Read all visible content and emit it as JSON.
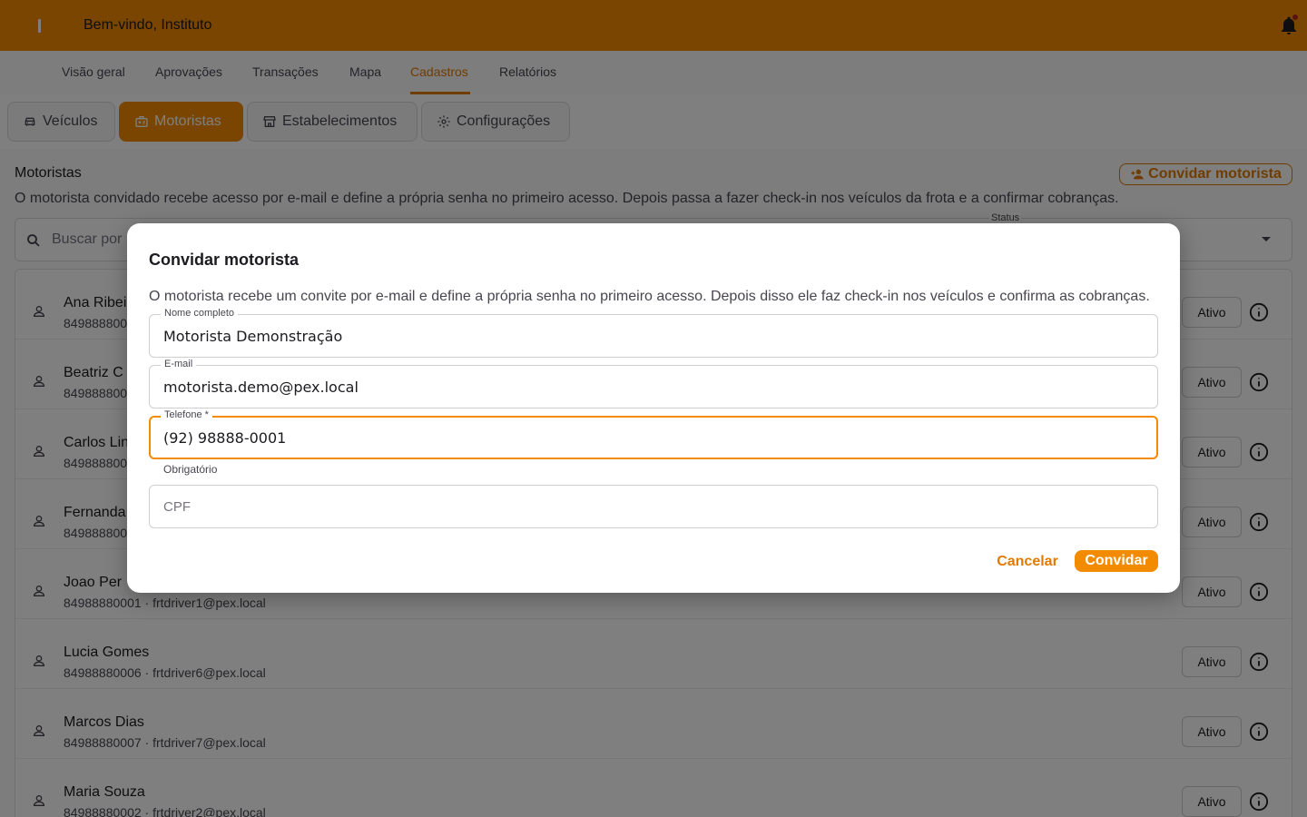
{
  "header": {
    "welcome": "Bem-vindo, Instituto",
    "notifications_icon": "bell-icon"
  },
  "nav": {
    "tabs": [
      {
        "label": "Visão geral"
      },
      {
        "label": "Aprovações"
      },
      {
        "label": "Transações"
      },
      {
        "label": "Mapa"
      },
      {
        "label": "Cadastros",
        "active": true
      },
      {
        "label": "Relatórios"
      }
    ]
  },
  "subtabs": [
    {
      "label": "Veículos",
      "icon": "car-icon"
    },
    {
      "label": "Motoristas",
      "icon": "id-badge-icon",
      "active": true
    },
    {
      "label": "Estabelecimentos",
      "icon": "store-icon"
    },
    {
      "label": "Configurações",
      "icon": "gear-icon"
    }
  ],
  "section": {
    "title": "Motoristas",
    "description": "O motorista convidado recebe acesso por e-mail e define a própria senha no primeiro acesso. Depois passa a fazer check-in nos veículos da frota e a confirmar cobranças.",
    "invite_button": "Convidar motorista",
    "search_placeholder": "Buscar por",
    "status_label": "Status"
  },
  "drivers": [
    {
      "name": "Ana Ribei",
      "meta": "849888800",
      "status": "Ativo"
    },
    {
      "name": "Beatriz C",
      "meta": "849888800",
      "status": "Ativo"
    },
    {
      "name": "Carlos Lin",
      "meta": "849888800",
      "status": "Ativo"
    },
    {
      "name": "Fernanda",
      "meta": "849888800",
      "status": "Ativo"
    },
    {
      "name": "Joao Per",
      "meta": "84988880001 · frtdriver1@pex.local",
      "status": "Ativo"
    },
    {
      "name": "Lucia Gomes",
      "meta": "84988880006 · frtdriver6@pex.local",
      "status": "Ativo"
    },
    {
      "name": "Marcos Dias",
      "meta": "84988880007 · frtdriver7@pex.local",
      "status": "Ativo"
    },
    {
      "name": "Maria Souza",
      "meta": "84988880002 · frtdriver2@pex.local",
      "status": "Ativo"
    }
  ],
  "dialog": {
    "title": "Convidar motorista",
    "description": "O motorista recebe um convite por e-mail e define a própria senha no primeiro acesso. Depois disso ele faz check-in nos veículos e confirma as cobranças.",
    "fields": {
      "name": {
        "label": "Nome completo",
        "value": "Motorista Demonstração"
      },
      "email": {
        "label": "E-mail",
        "value": "motorista.demo@pex.local"
      },
      "phone": {
        "label": "Telefone *",
        "value": "(92) 98888-0001",
        "helper": "Obrigatório"
      },
      "cpf": {
        "placeholder": "CPF"
      }
    },
    "cancel": "Cancelar",
    "submit": "Convidar"
  },
  "colors": {
    "brand": "#f28b00",
    "brand_dark": "#e07b00"
  }
}
